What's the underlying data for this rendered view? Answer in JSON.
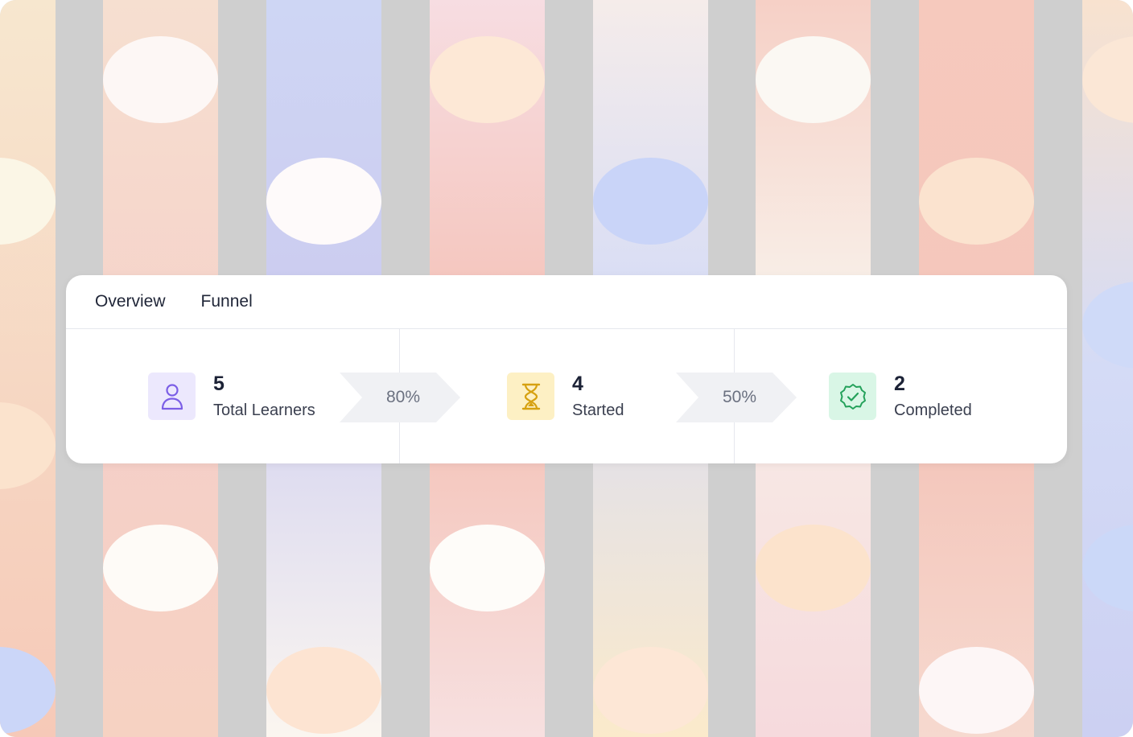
{
  "tabs": [
    {
      "label": "Overview"
    },
    {
      "label": "Funnel"
    }
  ],
  "funnel": {
    "steps": [
      {
        "value": "5",
        "label": "Total Learners",
        "icon": "user-icon",
        "icon_bg": "#ece8fd",
        "icon_color": "#7b5ee6"
      },
      {
        "value": "4",
        "label": "Started",
        "icon": "hourglass-icon",
        "icon_bg": "#fdf0c4",
        "icon_color": "#d6a111"
      },
      {
        "value": "2",
        "label": "Completed",
        "icon": "verified-badge-icon",
        "icon_bg": "#d9f6e6",
        "icon_color": "#23a15a"
      }
    ],
    "conversions": [
      {
        "label": "80%"
      },
      {
        "label": "50%"
      }
    ]
  },
  "colors": {
    "backdrop_gray": "#cfcfcf",
    "chevron_fill": "#f0f1f4"
  }
}
